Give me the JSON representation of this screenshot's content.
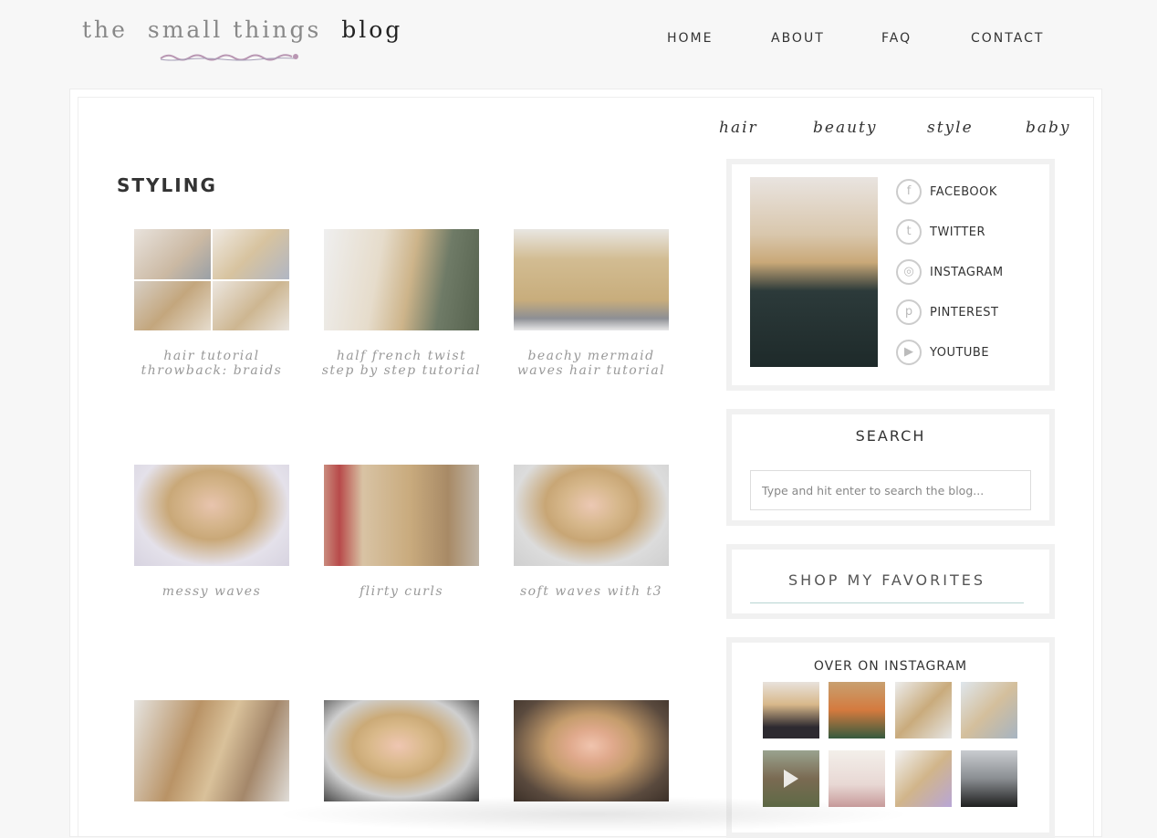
{
  "header": {
    "logo_word1": "the",
    "logo_word2": "small things",
    "logo_word3": "blog",
    "nav": [
      {
        "label": "HOME"
      },
      {
        "label": "ABOUT"
      },
      {
        "label": "FAQ"
      },
      {
        "label": "CONTACT"
      }
    ]
  },
  "categories": [
    {
      "label": "hair"
    },
    {
      "label": "beauty"
    },
    {
      "label": "style"
    },
    {
      "label": "baby"
    }
  ],
  "page_title": "STYLING",
  "posts": [
    {
      "title": "hair tutorial\nthrowback: braids"
    },
    {
      "title": "half french twist\nstep by step tutorial"
    },
    {
      "title": "beachy mermaid\nwaves hair tutorial"
    },
    {
      "title": "messy waves"
    },
    {
      "title": "flirty curls"
    },
    {
      "title": "soft waves with t3"
    },
    {
      "title": ""
    },
    {
      "title": ""
    },
    {
      "title": ""
    }
  ],
  "social": [
    {
      "label": "FACEBOOK",
      "icon": "facebook-icon",
      "glyph": "f"
    },
    {
      "label": "TWITTER",
      "icon": "twitter-icon",
      "glyph": "t"
    },
    {
      "label": "INSTAGRAM",
      "icon": "instagram-icon",
      "glyph": "◎"
    },
    {
      "label": "PINTEREST",
      "icon": "pinterest-icon",
      "glyph": "p"
    },
    {
      "label": "YOUTUBE",
      "icon": "youtube-icon",
      "glyph": "▶"
    }
  ],
  "search": {
    "title": "SEARCH",
    "placeholder": "Type and hit enter to search the blog..."
  },
  "shop": {
    "title": "SHOP MY  FAVORITES"
  },
  "instagram": {
    "title": "OVER ON INSTAGRAM"
  },
  "colors": {
    "accent_line": "#b7d5d2",
    "logo_squiggle": "#b997b3"
  }
}
